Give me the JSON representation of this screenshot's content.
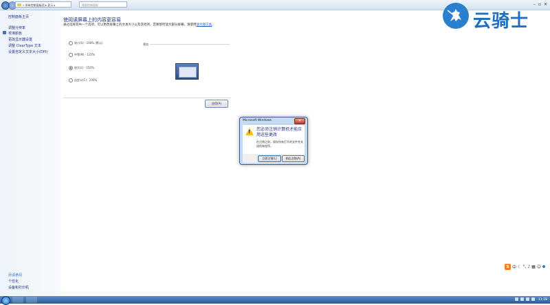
{
  "titlebar": {
    "address": "« 所有控制面板项 ▸ 显示 ▸",
    "search_placeholder": "搜索控制面板"
  },
  "sidebar": {
    "home": "控制面板主页",
    "items": [
      "调整分辨率",
      "校准颜色",
      "更改显示器设置",
      "调整 ClearType 文本",
      "设置自定义文本大小(DPI)"
    ],
    "see_also": "另请参阅",
    "see_also_items": [
      "个性化",
      "设备和打印机"
    ]
  },
  "main": {
    "heading": "使阅读屏幕上的内容更容易",
    "description": "通过选择其中一个选项，可以更改屏幕上的文本大小以及其他项。若要暂时放大部分屏幕，请使用",
    "description_link": "放大镜工具",
    "description_tail": "。",
    "options": [
      {
        "label": "较小(S) - 100% (默认)",
        "selected": false
      },
      {
        "label": "中等(M) - 125%",
        "selected": false
      },
      {
        "label": "较大(L) - 150%",
        "selected": true
      },
      {
        "label": "自定义(C)：200%",
        "selected": false
      }
    ],
    "preview_label": "预览",
    "apply_label": "应用(A)"
  },
  "dialog": {
    "title": "Microsoft Windows",
    "main_text": "您必须注销计算机才能应用这些更改",
    "sub_text": "在注销之前，保存所有打开的文件并关闭所有程序。",
    "buttons": [
      "立即注销(L)",
      "稍后注销(A)"
    ]
  },
  "watermark": {
    "text": "云骑士"
  },
  "ime": {
    "logo": "S",
    "mode": "中"
  },
  "taskbar": {
    "clock": "11:28"
  }
}
